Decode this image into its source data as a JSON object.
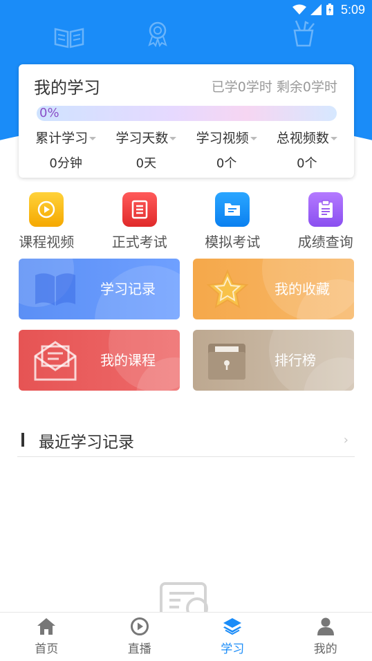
{
  "status_bar": {
    "time": "5:09"
  },
  "card": {
    "title": "我的学习",
    "remain_text": "已学0学时 剩余0学时",
    "progress_label": "0%",
    "progress_fraction": 0,
    "stats": [
      {
        "label": "累计学习",
        "value": "0分钟"
      },
      {
        "label": "学习天数",
        "value": "0天"
      },
      {
        "label": "学习视频",
        "value": "0个"
      },
      {
        "label": "总视频数",
        "value": "0个"
      }
    ]
  },
  "shortcuts": [
    {
      "label": "课程视频",
      "icon": "play-icon",
      "color": "#f7b500"
    },
    {
      "label": "正式考试",
      "icon": "document-icon",
      "color": "#ee3a3a"
    },
    {
      "label": "模拟考试",
      "icon": "folder-icon",
      "color": "#1a8cf8"
    },
    {
      "label": "成绩查询",
      "icon": "clipboard-icon",
      "color": "#9a5cf0"
    }
  ],
  "tiles": [
    {
      "label": "学习记录",
      "icon": "book-icon",
      "color": "#5a8cf6"
    },
    {
      "label": "我的收藏",
      "icon": "star-icon",
      "color": "#f4a94a"
    },
    {
      "label": "我的课程",
      "icon": "envelope-icon",
      "color": "#e85a5a"
    },
    {
      "label": "排行榜",
      "icon": "archive-box-icon",
      "color": "#c8b6a0"
    }
  ],
  "section": {
    "title": "最近学习记录",
    "chevron": "›"
  },
  "tabbar": {
    "active_index": 2,
    "active_color": "#1a8cf8",
    "items": [
      {
        "label": "首页",
        "icon": "home-icon"
      },
      {
        "label": "直播",
        "icon": "live-play-icon"
      },
      {
        "label": "学习",
        "icon": "study-layers-icon"
      },
      {
        "label": "我的",
        "icon": "user-icon"
      }
    ]
  }
}
